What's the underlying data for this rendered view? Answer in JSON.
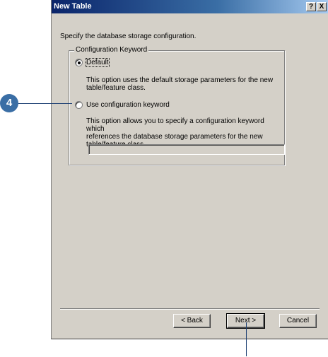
{
  "dialog": {
    "title": "New Table",
    "help_glyph": "?",
    "close_glyph": "X",
    "intro": "Specify the database storage configuration.",
    "group_label": "Configuration Keyword",
    "options": [
      {
        "label": "Default",
        "selected": true,
        "description_lines": [
          "This option uses the default storage parameters for the new",
          "table/feature class."
        ]
      },
      {
        "label": "Use configuration keyword",
        "selected": false,
        "description_lines": [
          "This option allows you to specify a configuration keyword which",
          "references the database storage parameters for the new",
          "table/feature class."
        ]
      }
    ],
    "keyword_value": "",
    "buttons": {
      "back": "< Back",
      "next": "Next >",
      "cancel": "Cancel"
    }
  },
  "callout": {
    "step": "4"
  },
  "colors": {
    "titlebar_start": "#0a246a",
    "titlebar_end": "#a6caf0",
    "dialog_face": "#d4d0c8",
    "callout": "#3a6ea5"
  }
}
